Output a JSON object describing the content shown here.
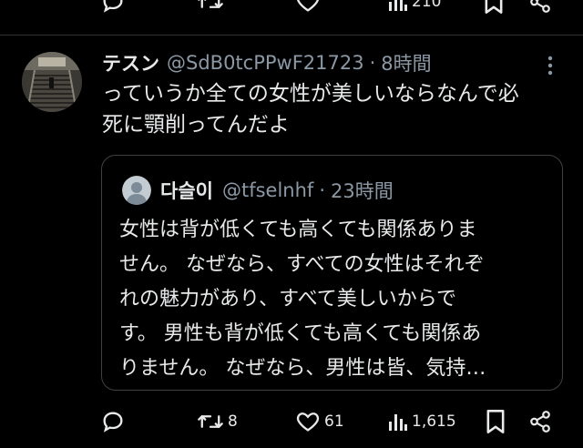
{
  "prev_tweet_actions": {
    "views_count": "210"
  },
  "tweet": {
    "display_name": "テスン",
    "handle": "@SdB0tcPPwF21723",
    "separator": "·",
    "time": "8時間",
    "text_lines": [
      "っていうか全ての女性が美しいならなんで必",
      "死に顎削ってんだよ"
    ]
  },
  "quote": {
    "display_name": "다슬이",
    "handle": "@tfselnhf",
    "separator": "·",
    "time": "23時間",
    "text_lines": [
      "女性は背が低くても高くても関係ありま",
      "せん。 なぜなら、すべての女性はそれぞ",
      "れの魅力があり、すべて美しいからで",
      "す。 男性も背が低くても高くても関係あ",
      "りません。 なぜなら、男性は皆、気持…"
    ]
  },
  "actions": {
    "replies": "",
    "retweets": "8",
    "likes": "61",
    "views": "1,615"
  },
  "icons": {
    "reply": "reply-icon",
    "retweet": "retweet-icon",
    "like": "heart-icon",
    "views": "views-icon",
    "bookmark": "bookmark-icon",
    "share": "share-icon",
    "more": "more-icon",
    "default_avatar": "default-avatar-icon"
  },
  "colors": {
    "background": "#000000",
    "text": "#e7e9ea",
    "secondary_text": "#8b98a5",
    "border": "#3e4144"
  }
}
